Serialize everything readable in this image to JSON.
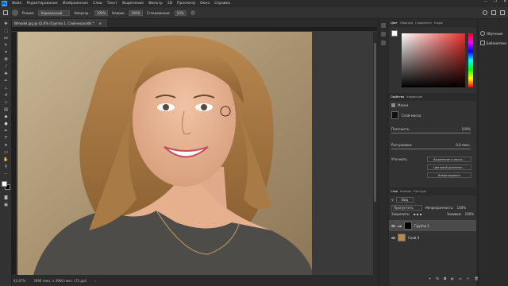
{
  "menubar": {
    "logo": "Ps",
    "items": [
      "Файл",
      "Редактирование",
      "Изображение",
      "Слои",
      "Текст",
      "Выделение",
      "Фильтр",
      "3D",
      "Просмотр",
      "Окно",
      "Справка"
    ],
    "window_controls": [
      "—",
      "❐",
      "✕"
    ]
  },
  "options": {
    "mode_label": "Режим:",
    "mode_value": "Нормальный",
    "opacity_label": "Непрозр.:",
    "opacity_value": "100%",
    "flow_label": "Нажим:",
    "flow_value": "100%",
    "smoothing_label": "Сглаживание:",
    "smoothing_value": "10%"
  },
  "document": {
    "tab_title": "Wmodel.jpg @ 42,6% (Группа 1, Слой-маска/8) *",
    "tab_close": "✕"
  },
  "status": {
    "zoom": "42,67%",
    "doc_info": "3990 пикс. x 3960 пикс. (72 ppi)"
  },
  "color_panel": {
    "tabs": [
      "Цвет",
      "Образцы",
      "Градиенты",
      "Узоры"
    ],
    "active_tab": 0,
    "base_color": "#e8302a"
  },
  "properties_panel": {
    "tabs": [
      "Свойства",
      "Коррекция"
    ],
    "mask_header": "Маски",
    "mask_name": "Слой-маска",
    "density_label": "Плотность:",
    "density_value": "100%",
    "feather_label": "Растушевка:",
    "feather_value": "0,0 пикс.",
    "refine_label": "Уточнить:",
    "select_mask_button": "Выделение и маска...",
    "color_range_button": "Цветовой диапазон...",
    "invert_button": "Инвертировать"
  },
  "layers_panel": {
    "tabs": [
      "Слои",
      "Каналы",
      "Контуры"
    ],
    "kind_label": "Вид",
    "blend_value": "Пропустить",
    "opacity_label": "Непрозрачность:",
    "opacity_value": "100%",
    "lock_label": "Закрепить:",
    "fill_label": "Заливка:",
    "fill_value": "100%",
    "layers": [
      {
        "name": "Группа 1",
        "selected": true
      },
      {
        "name": "Слой 0",
        "selected": false
      }
    ]
  },
  "right_column": {
    "items": [
      "Обучение",
      "Библиотеки"
    ]
  }
}
